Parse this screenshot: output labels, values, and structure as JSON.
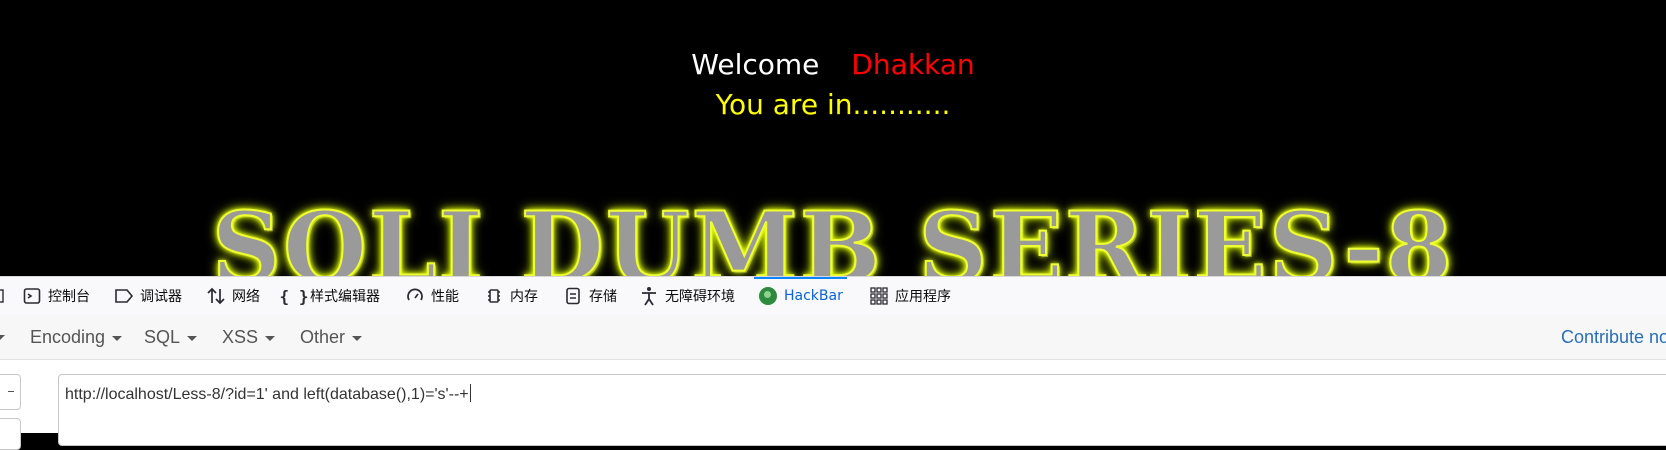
{
  "page": {
    "welcome_label": "Welcome",
    "user_name": "Dhakkan",
    "status_text": "You are in...........",
    "banner_text": "SQLI DUMB SERIES-8",
    "colors": {
      "background": "#000000",
      "welcome": "#ffffff",
      "name": "#ff0000",
      "status": "#ffff00",
      "banner_glow": "#e6ff00"
    }
  },
  "devtools": {
    "tabs": [
      {
        "label": "控制台",
        "icon": "console-icon"
      },
      {
        "label": "调试器",
        "icon": "debugger-icon"
      },
      {
        "label": "网络",
        "icon": "network-icon"
      },
      {
        "label": "样式编辑器",
        "icon": "style-editor-icon"
      },
      {
        "label": "性能",
        "icon": "performance-icon"
      },
      {
        "label": "内存",
        "icon": "memory-icon"
      },
      {
        "label": "存储",
        "icon": "storage-icon"
      },
      {
        "label": "无障碍环境",
        "icon": "accessibility-icon"
      },
      {
        "label": "HackBar",
        "icon": "hackbar-icon",
        "active": true
      },
      {
        "label": "应用程序",
        "icon": "application-icon"
      }
    ],
    "accent_color": "#0a84ff"
  },
  "hackbar": {
    "menus": [
      "Encoding",
      "SQL",
      "XSS",
      "Other"
    ],
    "contribute_label": "Contribute no",
    "url_value": "http://localhost/Less-8/?id=1' and left(database(),1)='s'--+"
  }
}
